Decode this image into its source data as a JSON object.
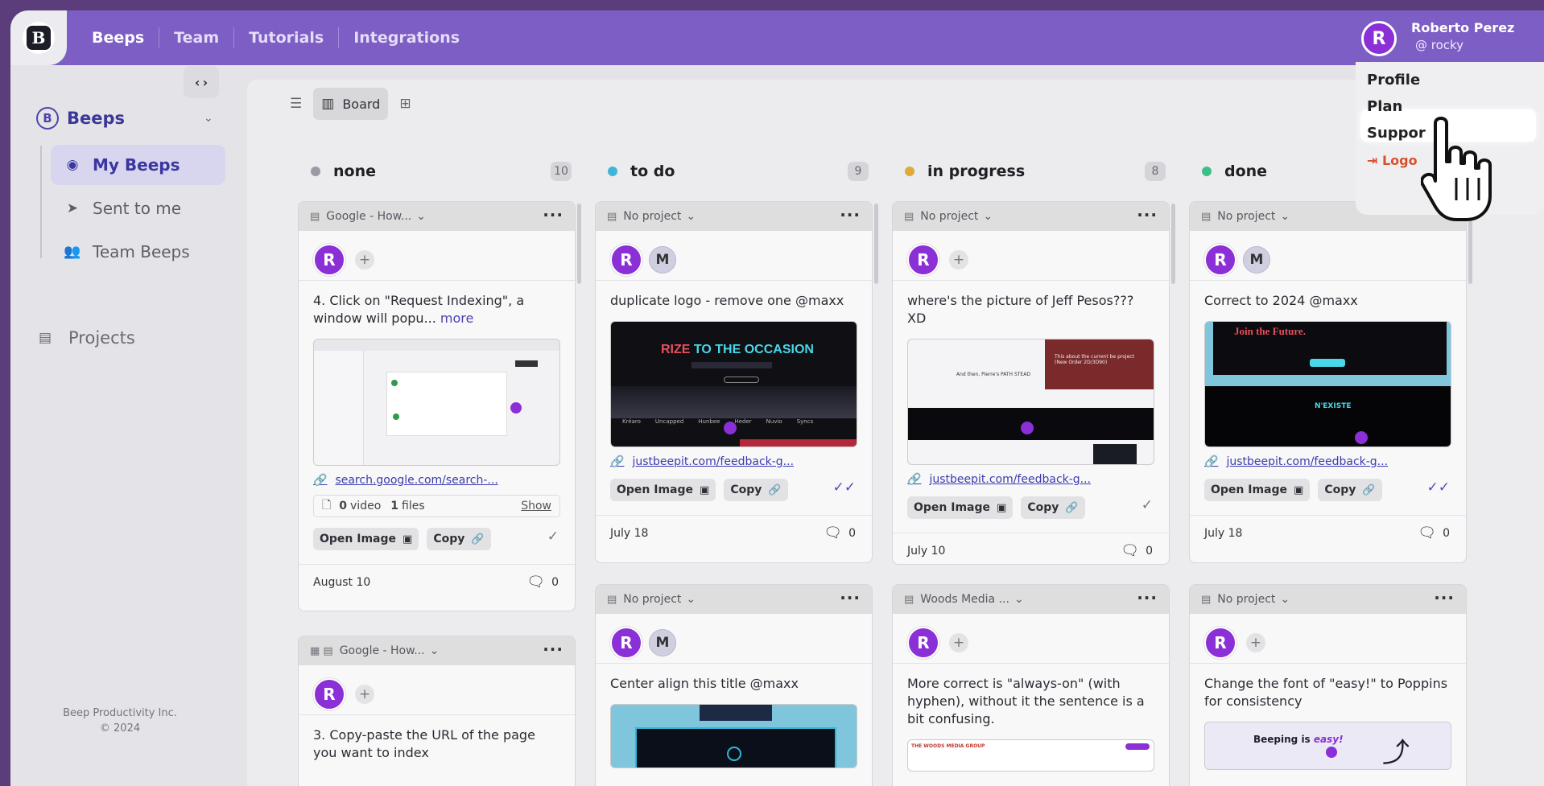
{
  "nav": {
    "items": [
      "Beeps",
      "Team",
      "Tutorials",
      "Integrations"
    ]
  },
  "user": {
    "name": "Roberto Perez",
    "handle": "@ rocky",
    "initial": "R"
  },
  "menu": {
    "items": [
      "Profile",
      "Plan",
      "Support",
      "Logout"
    ],
    "visible_texts": [
      "Profile",
      "Plan",
      "Suppor",
      "Logo"
    ],
    "hovered": "Plan"
  },
  "sidebar": {
    "workspace": "Beeps",
    "items": [
      {
        "label": "My Beeps",
        "icon": "user-circle-icon",
        "active": true
      },
      {
        "label": "Sent to me",
        "icon": "send-icon",
        "active": false
      },
      {
        "label": "Team Beeps",
        "icon": "team-icon",
        "active": false
      }
    ],
    "projects": "Projects",
    "footer_line1": "Beep Productivity Inc.",
    "footer_line2": "© 2024"
  },
  "toolbar": {
    "board_label": "Board"
  },
  "columns": [
    {
      "title": "none",
      "count": "10",
      "color": "#9a9aa2",
      "cards": [
        {
          "project": "Google - How...",
          "text": "4. Click on \"Request Indexing\", a window will popu...",
          "more": "more",
          "link": "search.google.com/search-...",
          "files_video_count": "0",
          "files_video": "video",
          "files_count": "1",
          "files_label": "files",
          "files_show": "Show",
          "btn_open": "Open Image",
          "btn_copy": "Copy",
          "date": "August 10",
          "comments": "0"
        },
        {
          "project": "Google - How...",
          "text": "3. Copy-paste the URL of the page you want to index"
        }
      ]
    },
    {
      "title": "to do",
      "count": "9",
      "color": "#3fb6d9",
      "cards": [
        {
          "project": "No project",
          "text": "duplicate logo - remove one @maxx",
          "link": "justbeepit.com/feedback-g...",
          "btn_open": "Open Image",
          "btn_copy": "Copy",
          "date": "July 18",
          "comments": "0",
          "thumb_heading_a": "RIZE",
          "thumb_heading_b": "TO THE OCCASION",
          "thumb_brands": [
            "Kréaro",
            "Uncapped",
            "Hunbee",
            "Heder",
            "Nuvio",
            "Syncs"
          ]
        },
        {
          "project": "No project",
          "text": "Center align this title @maxx"
        }
      ]
    },
    {
      "title": "in progress",
      "count": "8",
      "color": "#e0a93a",
      "cards": [
        {
          "project": "No project",
          "text": "where's the picture of Jeff Pesos??? XD",
          "link": "justbeepit.com/feedback-g...",
          "btn_open": "Open Image",
          "btn_copy": "Copy",
          "date": "July 10",
          "comments": "0",
          "thumb_note": "This about the current be project (New Order 2D/3D90)",
          "thumb_caption": "And then, Pierre's PATH STEAD"
        },
        {
          "project": "Woods Media ...",
          "text": "More correct is \"always-on\" (with hyphen), without it the sentence is a bit confusing.",
          "thumb_brand": "THE WOODS MEDIA GROUP"
        }
      ]
    },
    {
      "title": "done",
      "count": "",
      "color": "#3fbf88",
      "cards": [
        {
          "project": "No project",
          "text": "Correct to 2024 @maxx",
          "link": "justbeepit.com/feedback-g...",
          "btn_open": "Open Image",
          "btn_copy": "Copy",
          "date": "July 18",
          "comments": "0",
          "thumb_title": "Join the Future.",
          "thumb_subtitle": "N'EXISTE"
        },
        {
          "project": "No project",
          "text": "Change the font of \"easy!\" to Poppins for consistency",
          "thumb_text_a": "Beeping is",
          "thumb_text_b": "easy!"
        }
      ]
    }
  ]
}
